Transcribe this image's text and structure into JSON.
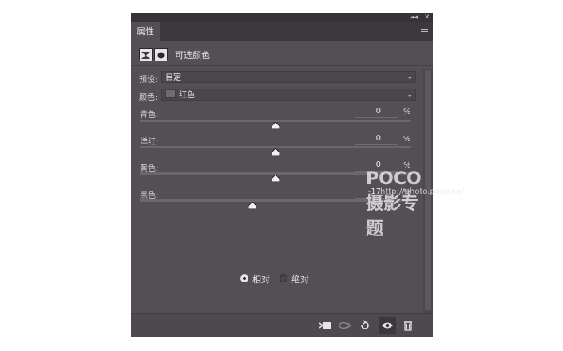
{
  "panel": {
    "topbar": {
      "collapse_glyph": "◂◂",
      "close_glyph": "✕"
    },
    "tab_label": "属性",
    "adjustment_title": "可选颜色",
    "preset": {
      "label": "预设:",
      "value": "自定"
    },
    "colors": {
      "label": "颜色:",
      "value": "红色",
      "swatch_color": "#6f6b6f"
    },
    "sliders": [
      {
        "label": "青色:",
        "value": "0",
        "unit": "%",
        "level_percent": 0
      },
      {
        "label": "洋红:",
        "value": "0",
        "unit": "%",
        "level_percent": 0
      },
      {
        "label": "黄色:",
        "value": "0",
        "unit": "%",
        "level_percent": 0
      },
      {
        "label": "黑色:",
        "value": "-17",
        "unit": "%",
        "level_percent": -17
      }
    ],
    "method": {
      "options": [
        {
          "label": "相对",
          "selected": true
        },
        {
          "label": "绝对",
          "selected": false
        }
      ]
    },
    "bottom_icons": [
      "clip-to-layer-icon",
      "view-previous-state-icon",
      "reset-icon",
      "visibility-eye-icon",
      "trash-icon"
    ],
    "watermark": {
      "brand": "POCO 摄影专题",
      "url": "http://photo.poco.cn/"
    }
  }
}
